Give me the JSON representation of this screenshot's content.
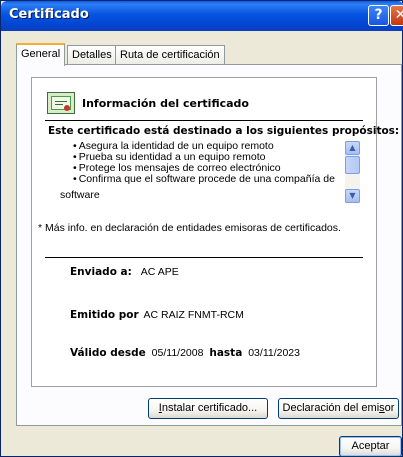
{
  "window": {
    "title": "Certificado",
    "help_label": "?",
    "close_label": "✕"
  },
  "tabs": [
    {
      "label": "General",
      "active": true
    },
    {
      "label": "Detalles",
      "active": false
    },
    {
      "label": "Ruta de certificación",
      "active": false
    }
  ],
  "certificate": {
    "icon": "certificate-icon",
    "info_title": "Información del certificado",
    "purpose_title": "Este certificado está destinado a los siguientes propósitos:",
    "purposes": [
      "Asegura la identidad de un equipo remoto",
      "Prueba su identidad a un equipo remoto",
      "Protege los mensajes de correo electrónico",
      "Confirma que el software procede de una compañía de"
    ],
    "purpose_continuation": "software",
    "more_info": "* Más info. en declaración de entidades emisoras de certificados.",
    "issued_to_label": "Enviado a:",
    "issued_to_value": "AC APE",
    "issued_by_label": "Emitido por",
    "issued_by_value": "AC RAIZ FNMT-RCM",
    "valid_from_label": "Válido desde",
    "valid_from_value": "05/11/2008",
    "valid_to_label": "hasta",
    "valid_to_value": "03/11/2023"
  },
  "buttons": {
    "install_first": "I",
    "install_rest": "nstalar certificado...",
    "declare_pre": "Declaración del emi",
    "declare_u": "s",
    "declare_post": "or",
    "accept": "Aceptar"
  },
  "colors": {
    "titlebar": "#0554e0",
    "dialog_bg": "#ece9d8",
    "active_tab_accent": "#f0b031",
    "close_button": "#c43810"
  }
}
